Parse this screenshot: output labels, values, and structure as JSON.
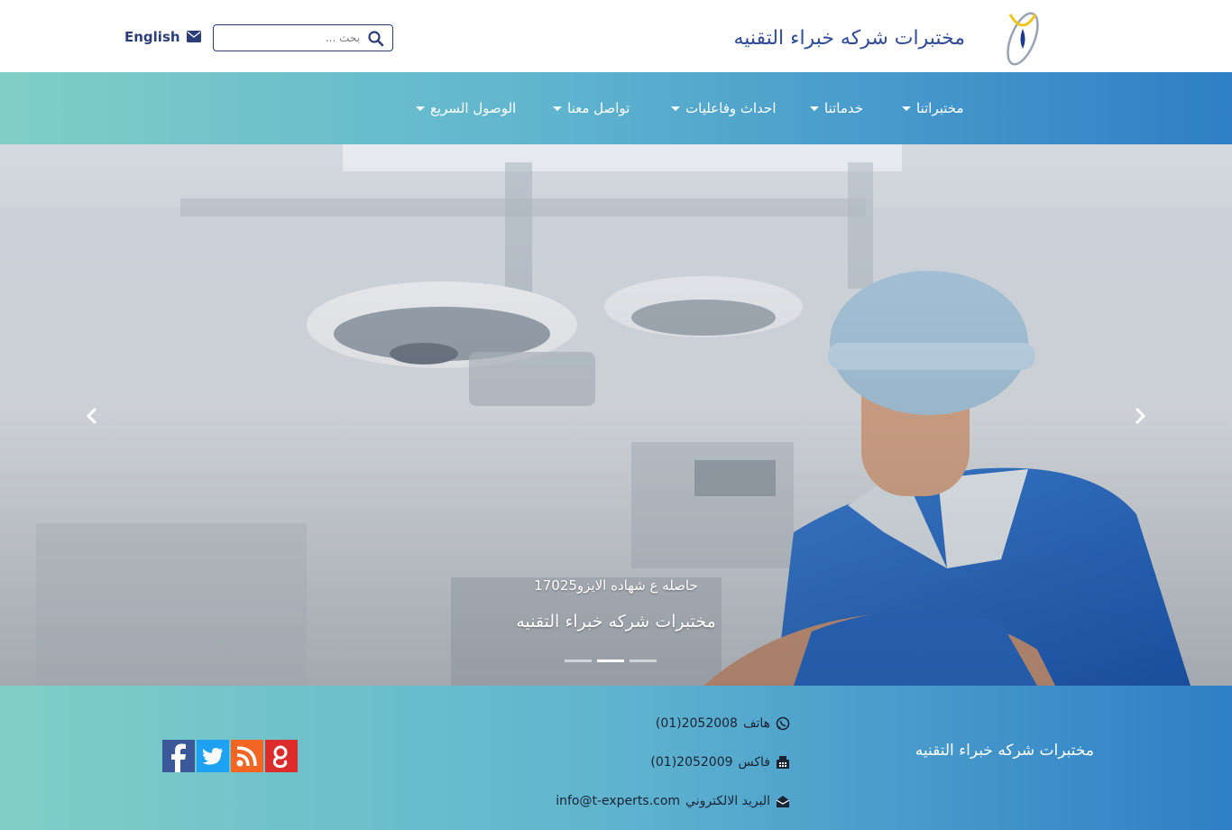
{
  "header": {
    "site_title": "مختبرات شركه خبراء التقنيه",
    "search_placeholder": "بحث ...",
    "language_link": "English"
  },
  "nav": {
    "items": [
      {
        "label": "مختبراتنا"
      },
      {
        "label": "خدماتنا"
      },
      {
        "label": "احداث وفاعليات"
      },
      {
        "label": "تواصل معنا"
      },
      {
        "label": "الوصول السريع"
      }
    ]
  },
  "hero": {
    "caption_subtitle": "حاصله ع شهاده الايزو17025",
    "caption_title": "مختبرات شركه خبراء التقنيه",
    "slide_count": 3,
    "active_slide": 2
  },
  "footer": {
    "brand": "مختبرات شركه خبراء التقنيه",
    "phone_label": "هاتف",
    "phone_value": "(01)2052008",
    "fax_label": "فاكس",
    "fax_value": "(01)2052009",
    "email_label": "البريد الالكتروني",
    "email_value": "info@t-experts.com"
  },
  "colors": {
    "brand_blue": "#2f4b9a",
    "gradient_start": "#7fcfc6",
    "gradient_end": "#2e7fc6"
  },
  "icons": [
    "logo-icon",
    "search-icon",
    "envelope-icon",
    "whatsapp-icon",
    "fax-icon",
    "envelope-open-icon",
    "facebook-icon",
    "twitter-icon",
    "rss-icon",
    "google-plus-icon",
    "chevron-left-icon",
    "chevron-right-icon"
  ]
}
